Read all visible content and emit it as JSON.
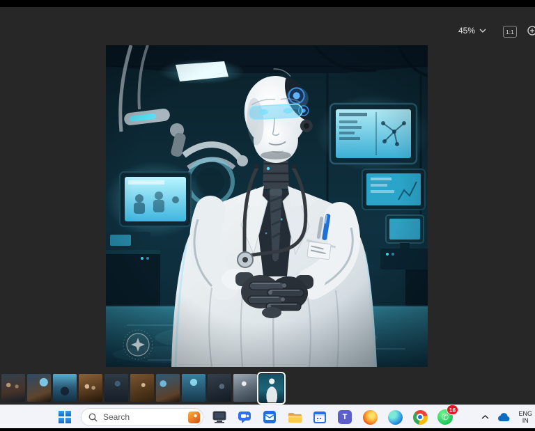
{
  "colors": {
    "viewer_bg": "#272727",
    "top_bar": "#000000",
    "taskbar_bg": "#f2f4f9",
    "accent_cyan": "#5fd8f0",
    "selected_thumb_border": "#eef6ef",
    "whatsapp_green": "#23c95e",
    "badge_red": "#e81224",
    "start_blue": "#1b76d3"
  },
  "toolbar": {
    "zoom_level": "45%",
    "actual_size_label": "1:1"
  },
  "photo": {
    "description": "AI-generated humanoid robot doctor with white skull, glowing blue mechanical brain, cyan glasses, white lab coat, stethoscope, blue pen and badge, dark robotic hands clasped, standing in a futuristic medical lab with glowing cyan monitors and teal reflective floor"
  },
  "filmstrip": {
    "selected_index": 10,
    "thumbs": [
      {
        "style": "background:radial-gradient(circle at 30% 40%, rgba(210,170,120,0.8) 0 9%, rgba(0,0,0,0) 10%), radial-gradient(circle at 65% 45%, rgba(190,150,110,0.7) 0 8%, rgba(0,0,0,0) 9%), linear-gradient(170deg,#33404e 0%,#46342a 60%,#181e26 100%)"
      },
      {
        "style": "background:radial-gradient(circle at 70% 30%, rgba(130,210,245,0.9) 0 16%, rgba(0,0,0,0) 17%), linear-gradient(160deg,#2c4a68 0%,#5e452c 70%,#1c140e 100%)"
      },
      {
        "style": "background:radial-gradient(circle at 50% 62%, rgba(18,30,42,0.85) 0 20%, rgba(0,0,0,0) 21%), linear-gradient(180deg,#58aed0 0%,#2a5a76 48%,#123042 100%)"
      },
      {
        "style": "background:radial-gradient(circle at 35% 45%, rgba(240,210,170,0.8) 0 10%, rgba(0,0,0,0) 11%), radial-gradient(circle at 62% 50%, rgba(220,190,150,0.7) 0 9%, rgba(0,0,0,0) 10%), linear-gradient(165deg,#8a6236 0%,#54371e 60%,#241608 100%)"
      },
      {
        "style": "background:radial-gradient(circle at 55% 35%, rgba(90,140,180,0.5) 0 12%, rgba(0,0,0,0) 13%), linear-gradient(180deg,#2e3a46 0%,#161e28 100%)"
      },
      {
        "style": "background:radial-gradient(circle at 55% 40%, rgba(250,225,180,0.75) 0 9%, rgba(0,0,0,0) 10%), linear-gradient(160deg,#7a5530 0%,#33220f 100%)"
      },
      {
        "style": "background:radial-gradient(circle at 30% 35%, rgba(120,200,240,0.85) 0 13%, rgba(0,0,0,0) 14%), linear-gradient(160deg,#2e5a78 0%,#5c402a 75%,#20150c 100%)"
      },
      {
        "style": "background:radial-gradient(circle at 50% 30%, rgba(150,230,255,0.85) 0 15%, rgba(0,0,0,0) 16%), linear-gradient(180deg,#3a80a0 0%,#173a4e 100%)"
      },
      {
        "style": "background:radial-gradient(circle at 60% 45%, rgba(160,190,210,0.4) 0 12%, rgba(0,0,0,0) 13%), linear-gradient(165deg,#34404c 0%,#131b24 100%)"
      },
      {
        "style": "background:radial-gradient(circle at 45% 35%, rgba(255,255,255,0.85) 0 10%, rgba(0,0,0,0) 11%), linear-gradient(160deg,#9cabb5 0%,#5c6a76 55%,#333e48 100%)"
      },
      {
        "style": "background:radial-gradient(circle at 52% 26%, #eef3f5 0 11%, rgba(238,243,245,0) 12%), radial-gradient(ellipse at 52% 78%, rgba(235,240,242,0.95) 0 30%, rgba(235,240,242,0) 31%), linear-gradient(180deg,#175064 0%,#1d6478 55%,#0d2f3f 100%)"
      }
    ]
  },
  "taskbar": {
    "search": {
      "placeholder": "Search"
    },
    "whatsapp_badge": "16",
    "icons": {
      "teams_letter": "T",
      "whatsapp_phone": "✆"
    },
    "language": {
      "line1": "ENG",
      "line2": "IN"
    }
  }
}
